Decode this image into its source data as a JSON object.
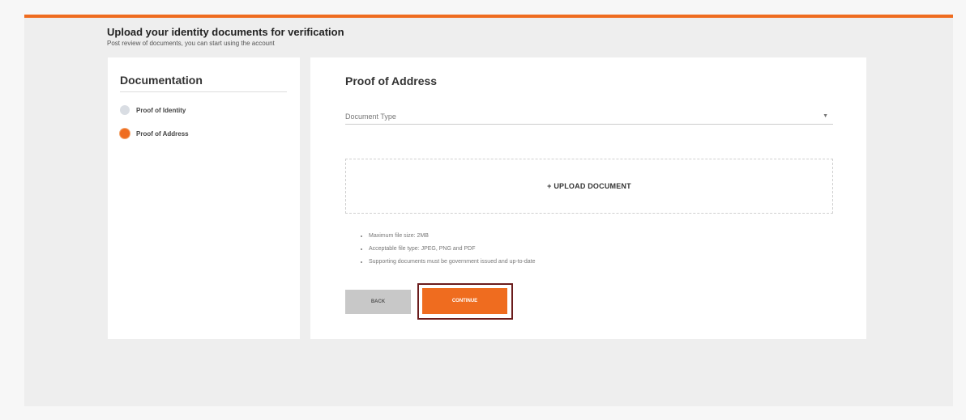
{
  "header": {
    "title": "Upload your identity documents for verification",
    "subtitle": "Post review of documents, you can start using the account"
  },
  "sidebar": {
    "heading": "Documentation",
    "steps": [
      {
        "label": "Proof of Identity",
        "active": false
      },
      {
        "label": "Proof of Address",
        "active": true
      }
    ]
  },
  "main": {
    "heading": "Proof of Address",
    "document_type_placeholder": "Document Type",
    "upload_label": "+ UPLOAD DOCUMENT",
    "rules": [
      "Maximum file size: 2MB",
      "Acceptable file type: JPEG, PNG and PDF",
      "Supporting documents must be government issued and up-to-date"
    ],
    "back_label": "BACK",
    "continue_label": "CONTINUE"
  },
  "colors": {
    "accent": "#ef6c1f",
    "highlight_outline": "#6b1c1c",
    "back_button": "#c8c8c8"
  }
}
